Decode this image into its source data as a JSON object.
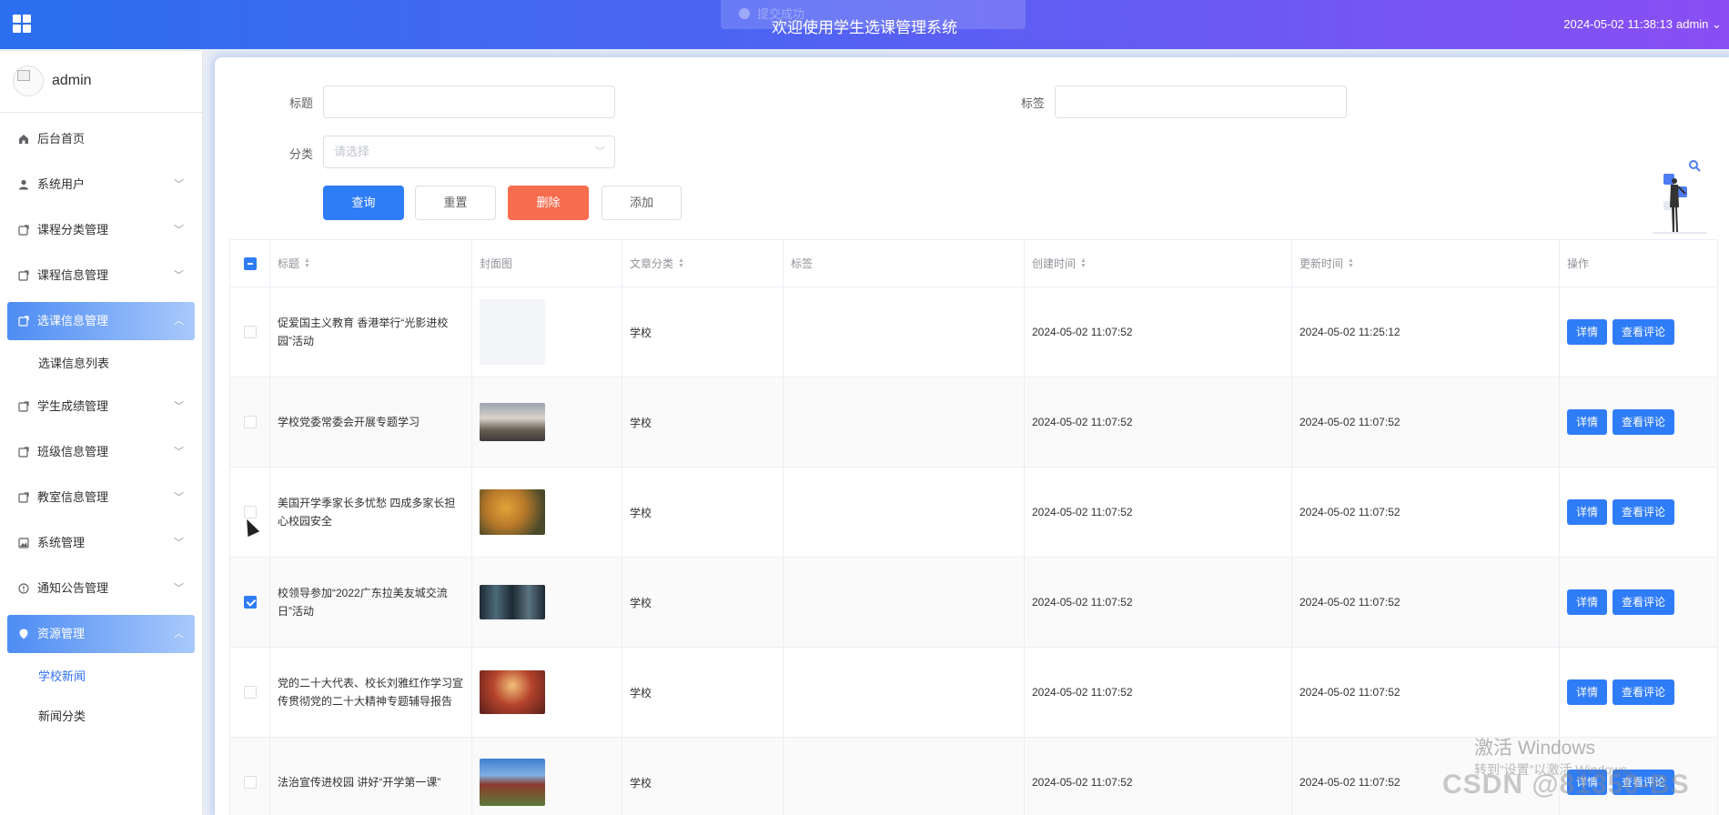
{
  "header": {
    "title": "欢迎使用学生选课管理系统",
    "toast": "提交成功",
    "datetime": "2024-05-02 11:38:13",
    "user": "admin"
  },
  "sidebar": {
    "username": "admin",
    "items": [
      {
        "label": "后台首页",
        "icon": "home-icon"
      },
      {
        "label": "系统用户",
        "icon": "user-icon"
      },
      {
        "label": "课程分类管理",
        "icon": "document-icon"
      },
      {
        "label": "课程信息管理",
        "icon": "document-icon"
      },
      {
        "label": "选课信息管理",
        "icon": "document-icon"
      },
      {
        "label": "选课信息列表",
        "icon": ""
      },
      {
        "label": "学生成绩管理",
        "icon": "document-icon"
      },
      {
        "label": "班级信息管理",
        "icon": "document-icon"
      },
      {
        "label": "教室信息管理",
        "icon": "document-icon"
      },
      {
        "label": "系统管理",
        "icon": "picture-icon"
      },
      {
        "label": "通知公告管理",
        "icon": "info-icon"
      },
      {
        "label": "资源管理",
        "icon": "location-icon"
      },
      {
        "label": "学校新闻",
        "icon": ""
      },
      {
        "label": "新闻分类",
        "icon": ""
      }
    ]
  },
  "search": {
    "title_label": "标题",
    "tag_label": "标签",
    "category_label": "分类",
    "category_placeholder": "请选择",
    "query": "查询",
    "reset": "重置",
    "delete": "删除",
    "add": "添加"
  },
  "table": {
    "columns": [
      "标题",
      "封面图",
      "文章分类",
      "标签",
      "创建时间",
      "更新时间",
      "操作"
    ],
    "action_detail": "详情",
    "action_comments": "查看评论",
    "rows": [
      {
        "title": "促爱国主义教育 香港举行“光影进校园”活动",
        "category": "学校",
        "tag": "",
        "created": "2024-05-02 11:07:52",
        "updated": "2024-05-02 11:25:12",
        "checked": false,
        "cover": "blank"
      },
      {
        "title": "学校党委常委会开展专题学习",
        "category": "学校",
        "tag": "",
        "created": "2024-05-02 11:07:52",
        "updated": "2024-05-02 11:07:52",
        "checked": false,
        "cover": "meeting"
      },
      {
        "title": "美国开学季家长多忧愁 四成多家长担心校园安全",
        "category": "学校",
        "tag": "",
        "created": "2024-05-02 11:07:52",
        "updated": "2024-05-02 11:07:52",
        "checked": false,
        "cover": "autumn"
      },
      {
        "title": "校领导参加“2022广东拉美友城交流日”活动",
        "category": "学校",
        "tag": "",
        "created": "2024-05-02 11:07:52",
        "updated": "2024-05-02 11:07:52",
        "checked": true,
        "cover": "screens"
      },
      {
        "title": "党的二十大代表、校长刘雅红作学习宣传贯彻党的二十大精神专题辅导报告",
        "category": "学校",
        "tag": "",
        "created": "2024-05-02 11:07:52",
        "updated": "2024-05-02 11:07:52",
        "checked": false,
        "cover": "hall"
      },
      {
        "title": "法治宣传进校园 讲好“开学第一课”",
        "category": "学校",
        "tag": "",
        "created": "2024-05-02 11:07:52",
        "updated": "2024-05-02 11:07:52",
        "checked": false,
        "cover": "building"
      }
    ]
  },
  "overlay": {
    "activate": "激活 Windows",
    "activate_sub": "转到“设置”以激活 Windows。",
    "csdn": "CSDN @81350-BS"
  },
  "colors": {
    "primary": "#2f7cf7",
    "danger": "#f56c4f",
    "header_start": "#2b6ff0",
    "header_end": "#8a4ef3"
  }
}
